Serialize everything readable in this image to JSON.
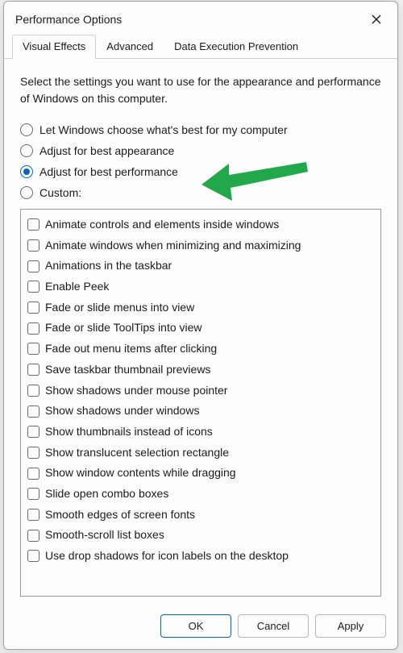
{
  "window": {
    "title": "Performance Options"
  },
  "tabs": [
    {
      "label": "Visual Effects",
      "active": true
    },
    {
      "label": "Advanced",
      "active": false
    },
    {
      "label": "Data Execution Prevention",
      "active": false
    }
  ],
  "intro": "Select the settings you want to use for the appearance and performance of Windows on this computer.",
  "radios": [
    {
      "label": "Let Windows choose what's best for my computer",
      "checked": false
    },
    {
      "label": "Adjust for best appearance",
      "checked": false
    },
    {
      "label": "Adjust for best performance",
      "checked": true
    },
    {
      "label": "Custom:",
      "checked": false
    }
  ],
  "effects": [
    "Animate controls and elements inside windows",
    "Animate windows when minimizing and maximizing",
    "Animations in the taskbar",
    "Enable Peek",
    "Fade or slide menus into view",
    "Fade or slide ToolTips into view",
    "Fade out menu items after clicking",
    "Save taskbar thumbnail previews",
    "Show shadows under mouse pointer",
    "Show shadows under windows",
    "Show thumbnails instead of icons",
    "Show translucent selection rectangle",
    "Show window contents while dragging",
    "Slide open combo boxes",
    "Smooth edges of screen fonts",
    "Smooth-scroll list boxes",
    "Use drop shadows for icon labels on the desktop"
  ],
  "buttons": {
    "ok": "OK",
    "cancel": "Cancel",
    "apply": "Apply"
  }
}
